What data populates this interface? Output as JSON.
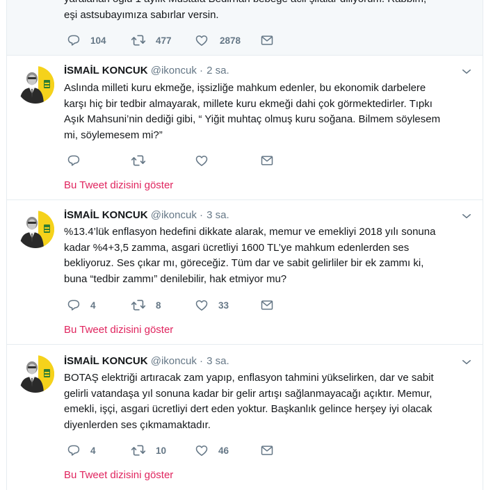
{
  "colors": {
    "accent": "#e0245e",
    "muted": "#657786",
    "border": "#e6ecf0",
    "avatar_yellow": "#f5d21b"
  },
  "previous_tweet": {
    "text": "yaralanan oğlu 1 aylık Mustafa Bedirhan bebeğe acil şifalar diliyorum. Rabbim,\neşi astsubayımıza sabırlar versin.",
    "replies": "104",
    "retweets": "477",
    "likes": "2878"
  },
  "tweets": [
    {
      "fullname": "İSMAİL KONCUK",
      "handle": "@ikoncuk",
      "dot": "·",
      "time": "2 sa.",
      "text": "Aslında milleti kuru ekmeğe, işsizliğe mahkum edenler, bu ekonomik darbelere\nkarşı hiç bir tedbir almayarak, millete kuru ekmeği dahi çok görmektedirler. Tıpkı\nAşık Mahsuni’nin dediği gibi, “ Yiğit muhtaç olmuş kuru soğana. Bilmem söylesem\nmi, söylemesem mi?”",
      "replies": "",
      "retweets": "",
      "likes": "",
      "thread_link": "Bu Tweet dizisini göster"
    },
    {
      "fullname": "İSMAİL KONCUK",
      "handle": "@ikoncuk",
      "dot": "·",
      "time": "3 sa.",
      "text": "%13.4’lük enflasyon hedefini dikkate alarak, memur ve emekliyi 2018 yılı sonuna\nkadar %4+3,5 zamma, asgari ücretliyi 1600 TL’ye mahkum edenlerden ses\nbekliyoruz. Ses çıkar mı, göreceğiz. Tüm dar ve sabit gelirliler bir ek zammı ki,\nbuna “tedbir zammı” denilebilir, hak etmiyor mu?",
      "replies": "4",
      "retweets": "8",
      "likes": "33",
      "thread_link": "Bu Tweet dizisini göster"
    },
    {
      "fullname": "İSMAİL KONCUK",
      "handle": "@ikoncuk",
      "dot": "·",
      "time": "3 sa.",
      "text": "BOTAŞ elektriği artıracak zam yapıp, enflasyon tahmini yükselirken, dar ve sabit\ngelirli vatandaşa yıl sonuna kadar bir gelir artışı sağlanmayacağı açıktır. Memur,\nemekli, işçi, asgari ücretliyi dert eden yoktur. Başkanlık gelince herşey iyi olacak\ndiyenlerden ses çıkmamaktadır.",
      "replies": "4",
      "retweets": "10",
      "likes": "46",
      "thread_link": "Bu Tweet dizisini göster"
    }
  ]
}
